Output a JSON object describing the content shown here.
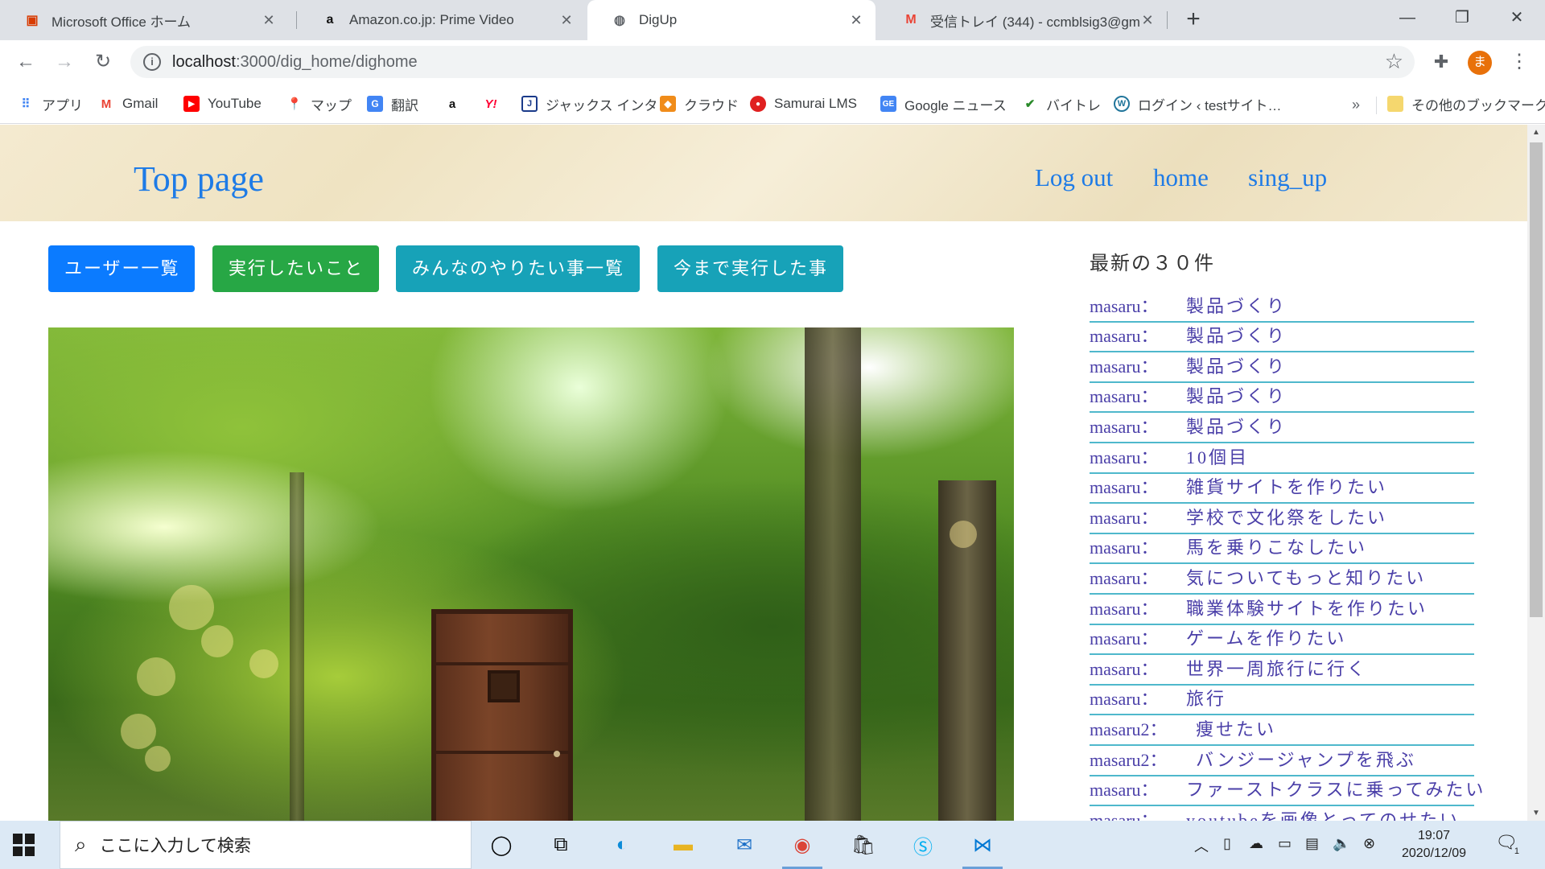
{
  "browser": {
    "tabs": [
      {
        "label": "Microsoft Office ホーム",
        "icon": "office-icon"
      },
      {
        "label": "Amazon.co.jp: Prime Video",
        "icon": "amazon-icon"
      },
      {
        "label": "DigUp",
        "icon": "globe-icon",
        "active": true
      },
      {
        "label": "受信トレイ (344) - ccmblsig3@gm",
        "icon": "gmail-icon"
      }
    ],
    "url_host": "localhost",
    "url_path": ":3000/dig_home/dighome",
    "profile_initial": "ま",
    "bookmarks": [
      {
        "label": "アプリ",
        "icon": "apps-grid-icon"
      },
      {
        "label": "Gmail",
        "icon": "gmail-icon"
      },
      {
        "label": "YouTube",
        "icon": "youtube-icon"
      },
      {
        "label": "マップ",
        "icon": "maps-pin-icon"
      },
      {
        "label": "翻訳",
        "icon": "translate-icon"
      },
      {
        "label": "",
        "icon": "amazon-icon"
      },
      {
        "label": "",
        "icon": "yahoo-icon"
      },
      {
        "label": "ジャックス インタ",
        "icon": "jaccs-icon"
      },
      {
        "label": "クラウド",
        "icon": "cloud-box-icon"
      },
      {
        "label": "Samurai LMS",
        "icon": "samurai-icon"
      },
      {
        "label": "Google ニュース",
        "icon": "google-news-icon"
      },
      {
        "label": "バイトレ",
        "icon": "baitore-icon"
      },
      {
        "label": "ログイン ‹ testサイト…",
        "icon": "wordpress-icon"
      }
    ],
    "bookmarks_more": "»",
    "other_bookmarks": "その他のブックマーク"
  },
  "site": {
    "title": "Top page",
    "nav": [
      "Log out",
      "home",
      "sing_up"
    ]
  },
  "actions": [
    {
      "label": "ユーザー一覧",
      "color": "#0b7bff"
    },
    {
      "label": "実行したいこと",
      "color": "#27a745"
    },
    {
      "label": "みんなのやりたい事一覧",
      "color": "#17a2b8"
    },
    {
      "label": "今まで実行した事",
      "color": "#17a2b8"
    }
  ],
  "latest": {
    "title": "最新の３０件",
    "items": [
      {
        "user": "masaru：",
        "text": "製品づくり"
      },
      {
        "user": "masaru：",
        "text": "製品づくり"
      },
      {
        "user": "masaru：",
        "text": "製品づくり"
      },
      {
        "user": "masaru：",
        "text": "製品づくり"
      },
      {
        "user": "masaru：",
        "text": "製品づくり"
      },
      {
        "user": "masaru：",
        "text": "10個目"
      },
      {
        "user": "masaru：",
        "text": "雑貨サイトを作りたい"
      },
      {
        "user": "masaru：",
        "text": "学校で文化祭をしたい"
      },
      {
        "user": "masaru：",
        "text": "馬を乗りこなしたい"
      },
      {
        "user": "masaru：",
        "text": "気についてもっと知りたい"
      },
      {
        "user": "masaru：",
        "text": "職業体験サイトを作りたい"
      },
      {
        "user": "masaru：",
        "text": "ゲームを作りたい"
      },
      {
        "user": "masaru：",
        "text": "世界一周旅行に行く"
      },
      {
        "user": "masaru：",
        "text": "旅行"
      },
      {
        "user": "masaru2：",
        "text": "痩せたい"
      },
      {
        "user": "masaru2：",
        "text": "バンジージャンプを飛ぶ"
      },
      {
        "user": "masaru：",
        "text": "ファーストクラスに乗ってみたい"
      },
      {
        "user": "masaru：",
        "text": "youtubeを画像とってのせたい"
      }
    ]
  },
  "taskbar": {
    "search_placeholder": "ここに入力して検索",
    "time": "19:07",
    "date": "2020/12/09",
    "notification_count": "1"
  }
}
